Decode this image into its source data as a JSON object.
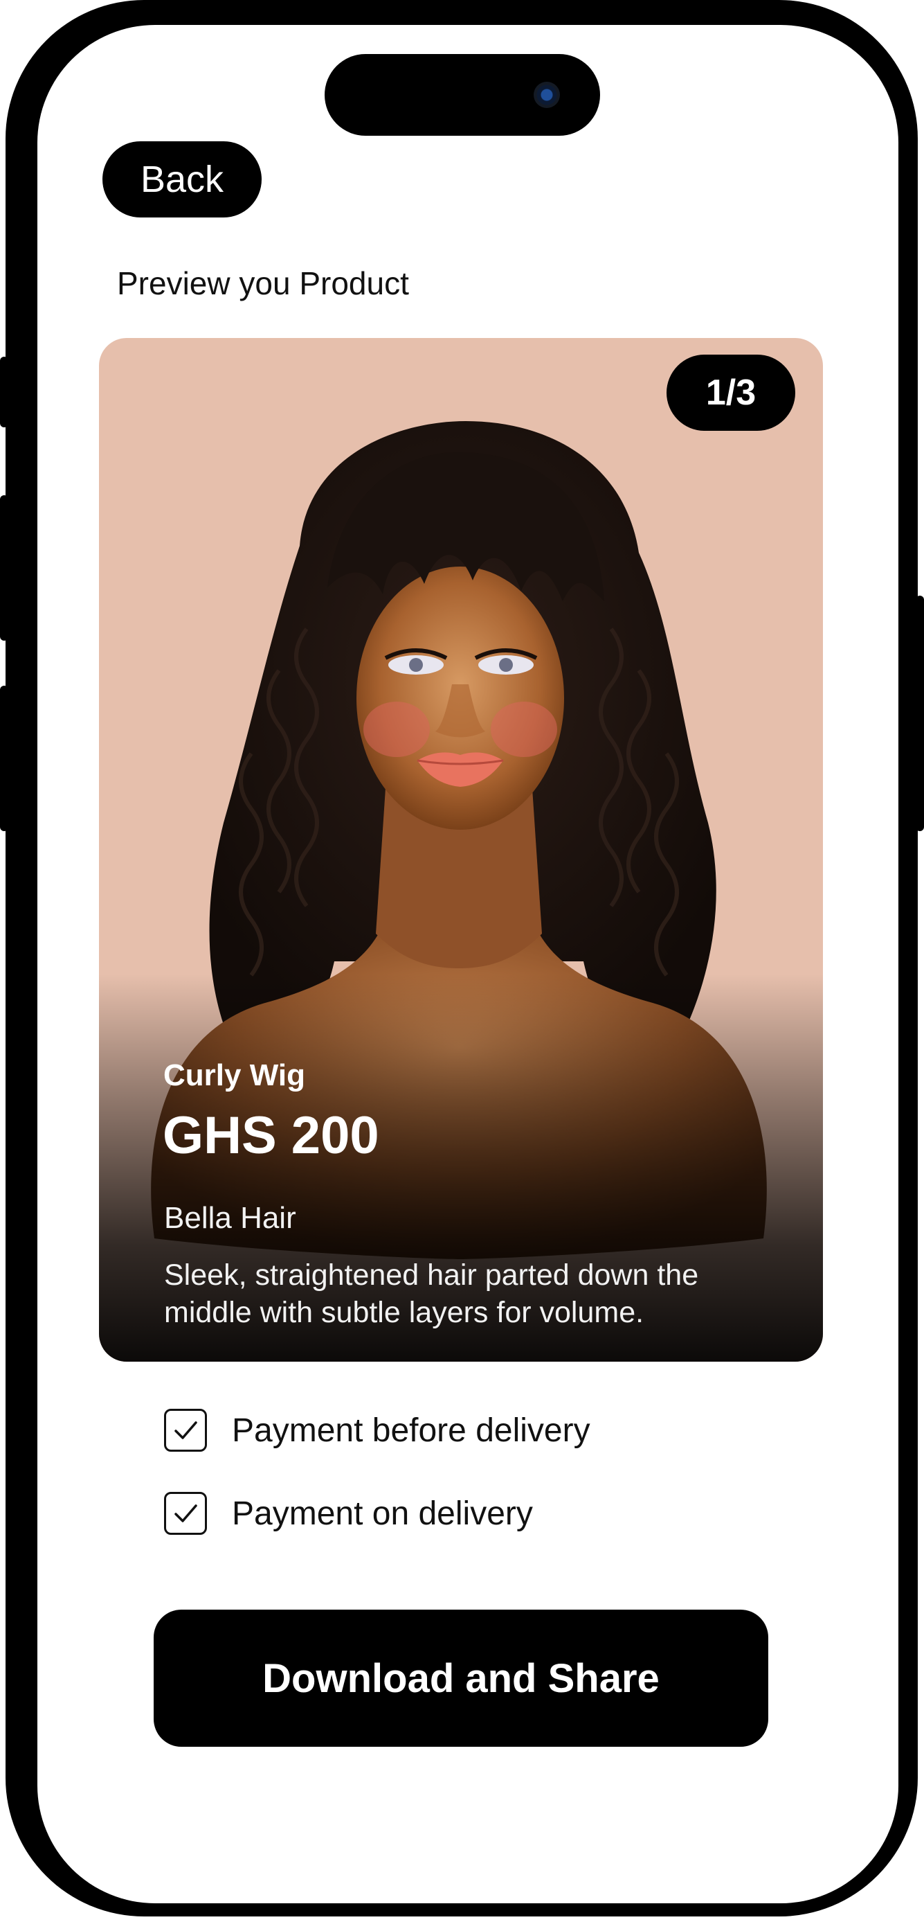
{
  "header": {
    "back_label": "Back",
    "page_title": "Preview you Product"
  },
  "card": {
    "image_counter": "1/3",
    "product_name": "Curly Wig",
    "price": "GHS 200",
    "brand": "Bella Hair",
    "description": "Sleek, straightened hair parted down the middle with subtle layers for volume.",
    "background_color": "#e6bfac"
  },
  "payment_options": [
    {
      "label": "Payment before delivery",
      "checked": true
    },
    {
      "label": "Payment on delivery",
      "checked": true
    }
  ],
  "actions": {
    "download_share_label": "Download and Share"
  },
  "icons": {
    "checkbox": "check-icon",
    "camera": "camera-icon"
  },
  "colors": {
    "primary": "#000000",
    "surface": "#ffffff",
    "card_bg": "#e6bfac"
  }
}
